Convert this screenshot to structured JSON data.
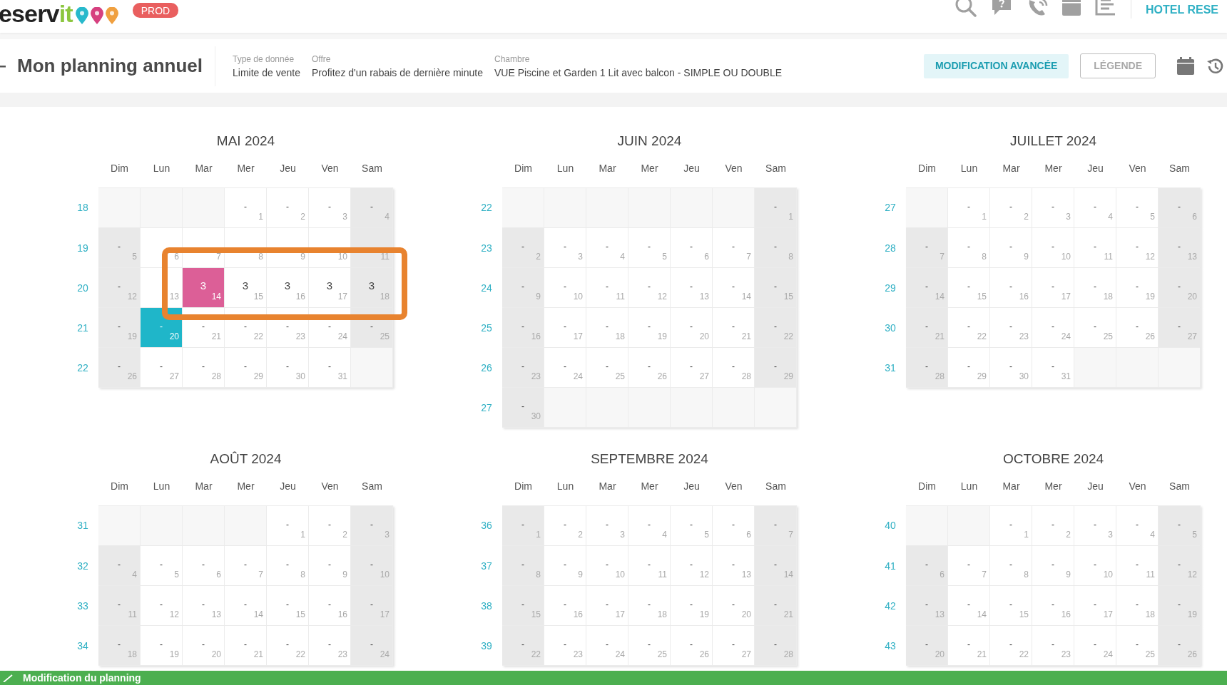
{
  "header": {
    "logo": {
      "main": "eserv",
      "accent": "it"
    },
    "env_badge": "PROD",
    "hotel": "HOTEL RESE"
  },
  "subheader": {
    "title": "Mon planning annuel",
    "fields": [
      {
        "label": "Type de donnée",
        "value": "Limite de vente"
      },
      {
        "label": "Offre",
        "value": "Profitez d'un rabais de dernière minute"
      },
      {
        "label": "Chambre",
        "value": "VUE Piscine et Garden 1 Lit avec balcon - SIMPLE OU DOUBLE"
      }
    ],
    "buttons": [
      {
        "label": "MODIFICATION AVANCÉE",
        "kind": "primary"
      },
      {
        "label": "LÉGENDE",
        "kind": "outline"
      }
    ]
  },
  "months": [
    {
      "title": "MAI 2024",
      "weekdays": [
        "Dim",
        "Lun",
        "Mar",
        "Mer",
        "Jeu",
        "Ven",
        "Sam"
      ],
      "weeks": [
        {
          "number": "18",
          "days": [
            {
              "kind": "blank"
            },
            {
              "kind": "blank"
            },
            {
              "kind": "blank"
            },
            {
              "day": "1",
              "value": "-"
            },
            {
              "day": "2",
              "value": "-"
            },
            {
              "day": "3",
              "value": "-"
            },
            {
              "day": "4",
              "value": "-"
            }
          ]
        },
        {
          "number": "19",
          "days": [
            {
              "day": "5",
              "value": "-"
            },
            {
              "day": "6"
            },
            {
              "day": "7"
            },
            {
              "day": "8"
            },
            {
              "day": "9"
            },
            {
              "day": "10"
            },
            {
              "day": "11"
            }
          ]
        },
        {
          "number": "20",
          "days": [
            {
              "day": "12",
              "value": "-"
            },
            {
              "day": "13"
            },
            {
              "day": "14",
              "value": "3",
              "color": "#dc5f97"
            },
            {
              "day": "15",
              "value": "3"
            },
            {
              "day": "16",
              "value": "3"
            },
            {
              "day": "17",
              "value": "3"
            },
            {
              "day": "18",
              "value": "3"
            }
          ]
        },
        {
          "number": "21",
          "days": [
            {
              "day": "19",
              "value": "-"
            },
            {
              "day": "20",
              "value": "-",
              "color": "#1fb6c9"
            },
            {
              "day": "21",
              "value": "-"
            },
            {
              "day": "22",
              "value": "-"
            },
            {
              "day": "23",
              "value": "-"
            },
            {
              "day": "24",
              "value": "-"
            },
            {
              "day": "25",
              "value": "-"
            }
          ]
        },
        {
          "number": "22",
          "days": [
            {
              "day": "26",
              "value": "-"
            },
            {
              "day": "27",
              "value": "-"
            },
            {
              "day": "28",
              "value": "-"
            },
            {
              "day": "29",
              "value": "-"
            },
            {
              "day": "30",
              "value": "-"
            },
            {
              "day": "31",
              "value": "-"
            },
            {
              "kind": "blank"
            }
          ]
        }
      ]
    },
    {
      "title": "JUIN 2024",
      "weekdays": [
        "Dim",
        "Lun",
        "Mar",
        "Mer",
        "Jeu",
        "Ven",
        "Sam"
      ],
      "weeks": [
        {
          "number": "22",
          "days": [
            {
              "kind": "blank"
            },
            {
              "kind": "blank"
            },
            {
              "kind": "blank"
            },
            {
              "kind": "blank"
            },
            {
              "kind": "blank"
            },
            {
              "kind": "blank"
            },
            {
              "day": "1",
              "value": "-"
            }
          ]
        },
        {
          "number": "23",
          "days": [
            {
              "day": "2",
              "value": "-"
            },
            {
              "day": "3",
              "value": "-"
            },
            {
              "day": "4",
              "value": "-"
            },
            {
              "day": "5",
              "value": "-"
            },
            {
              "day": "6",
              "value": "-"
            },
            {
              "day": "7",
              "value": "-"
            },
            {
              "day": "8",
              "value": "-"
            }
          ]
        },
        {
          "number": "24",
          "days": [
            {
              "day": "9",
              "value": "-"
            },
            {
              "day": "10",
              "value": "-"
            },
            {
              "day": "11",
              "value": "-"
            },
            {
              "day": "12",
              "value": "-"
            },
            {
              "day": "13",
              "value": "-"
            },
            {
              "day": "14",
              "value": "-"
            },
            {
              "day": "15",
              "value": "-"
            }
          ]
        },
        {
          "number": "25",
          "days": [
            {
              "day": "16",
              "value": "-"
            },
            {
              "day": "17",
              "value": "-"
            },
            {
              "day": "18",
              "value": "-"
            },
            {
              "day": "19",
              "value": "-"
            },
            {
              "day": "20",
              "value": "-"
            },
            {
              "day": "21",
              "value": "-"
            },
            {
              "day": "22",
              "value": "-"
            }
          ]
        },
        {
          "number": "26",
          "days": [
            {
              "day": "23",
              "value": "-"
            },
            {
              "day": "24",
              "value": "-"
            },
            {
              "day": "25",
              "value": "-"
            },
            {
              "day": "26",
              "value": "-"
            },
            {
              "day": "27",
              "value": "-"
            },
            {
              "day": "28",
              "value": "-"
            },
            {
              "day": "29",
              "value": "-"
            }
          ]
        },
        {
          "number": "27",
          "days": [
            {
              "day": "30",
              "value": "-"
            },
            {
              "kind": "blank"
            },
            {
              "kind": "blank"
            },
            {
              "kind": "blank"
            },
            {
              "kind": "blank"
            },
            {
              "kind": "blank"
            },
            {
              "kind": "blank"
            }
          ]
        }
      ]
    },
    {
      "title": "JUILLET 2024",
      "weekdays": [
        "Dim",
        "Lun",
        "Mar",
        "Mer",
        "Jeu",
        "Ven",
        "Sam"
      ],
      "weeks": [
        {
          "number": "27",
          "days": [
            {
              "kind": "blank"
            },
            {
              "day": "1",
              "value": "-"
            },
            {
              "day": "2",
              "value": "-"
            },
            {
              "day": "3",
              "value": "-"
            },
            {
              "day": "4",
              "value": "-"
            },
            {
              "day": "5",
              "value": "-"
            },
            {
              "day": "6",
              "value": "-"
            }
          ]
        },
        {
          "number": "28",
          "days": [
            {
              "day": "7",
              "value": "-"
            },
            {
              "day": "8",
              "value": "-"
            },
            {
              "day": "9",
              "value": "-"
            },
            {
              "day": "10",
              "value": "-"
            },
            {
              "day": "11",
              "value": "-"
            },
            {
              "day": "12",
              "value": "-"
            },
            {
              "day": "13",
              "value": "-"
            }
          ]
        },
        {
          "number": "29",
          "days": [
            {
              "day": "14",
              "value": "-"
            },
            {
              "day": "15",
              "value": "-"
            },
            {
              "day": "16",
              "value": "-"
            },
            {
              "day": "17",
              "value": "-"
            },
            {
              "day": "18",
              "value": "-"
            },
            {
              "day": "19",
              "value": "-"
            },
            {
              "day": "20",
              "value": "-"
            }
          ]
        },
        {
          "number": "30",
          "days": [
            {
              "day": "21",
              "value": "-"
            },
            {
              "day": "22",
              "value": "-"
            },
            {
              "day": "23",
              "value": "-"
            },
            {
              "day": "24",
              "value": "-"
            },
            {
              "day": "25",
              "value": "-"
            },
            {
              "day": "26",
              "value": "-"
            },
            {
              "day": "27",
              "value": "-"
            }
          ]
        },
        {
          "number": "31",
          "days": [
            {
              "day": "28",
              "value": "-"
            },
            {
              "day": "29",
              "value": "-"
            },
            {
              "day": "30",
              "value": "-"
            },
            {
              "day": "31",
              "value": "-"
            },
            {
              "kind": "blank"
            },
            {
              "kind": "blank"
            },
            {
              "kind": "blank"
            }
          ]
        }
      ]
    },
    {
      "title": "AOÛT 2024",
      "weekdays": [
        "Dim",
        "Lun",
        "Mar",
        "Mer",
        "Jeu",
        "Ven",
        "Sam"
      ],
      "weeks": [
        {
          "number": "31",
          "days": [
            {
              "kind": "blank"
            },
            {
              "kind": "blank"
            },
            {
              "kind": "blank"
            },
            {
              "kind": "blank"
            },
            {
              "day": "1",
              "value": "-"
            },
            {
              "day": "2",
              "value": "-"
            },
            {
              "day": "3",
              "value": "-"
            }
          ]
        },
        {
          "number": "32",
          "days": [
            {
              "day": "4",
              "value": "-"
            },
            {
              "day": "5",
              "value": "-"
            },
            {
              "day": "6",
              "value": "-"
            },
            {
              "day": "7",
              "value": "-"
            },
            {
              "day": "8",
              "value": "-"
            },
            {
              "day": "9",
              "value": "-"
            },
            {
              "day": "10",
              "value": "-"
            }
          ]
        },
        {
          "number": "33",
          "days": [
            {
              "day": "11",
              "value": "-"
            },
            {
              "day": "12",
              "value": "-"
            },
            {
              "day": "13",
              "value": "-"
            },
            {
              "day": "14",
              "value": "-"
            },
            {
              "day": "15",
              "value": "-"
            },
            {
              "day": "16",
              "value": "-"
            },
            {
              "day": "17",
              "value": "-"
            }
          ]
        },
        {
          "number": "34",
          "days": [
            {
              "day": "18",
              "value": "-"
            },
            {
              "day": "19",
              "value": "-"
            },
            {
              "day": "20",
              "value": "-"
            },
            {
              "day": "21",
              "value": "-"
            },
            {
              "day": "22",
              "value": "-"
            },
            {
              "day": "23",
              "value": "-"
            },
            {
              "day": "24",
              "value": "-"
            }
          ]
        }
      ]
    },
    {
      "title": "SEPTEMBRE 2024",
      "weekdays": [
        "Dim",
        "Lun",
        "Mar",
        "Mer",
        "Jeu",
        "Ven",
        "Sam"
      ],
      "weeks": [
        {
          "number": "36",
          "days": [
            {
              "day": "1",
              "value": "-"
            },
            {
              "day": "2",
              "value": "-"
            },
            {
              "day": "3",
              "value": "-"
            },
            {
              "day": "4",
              "value": "-"
            },
            {
              "day": "5",
              "value": "-"
            },
            {
              "day": "6",
              "value": "-"
            },
            {
              "day": "7",
              "value": "-"
            }
          ]
        },
        {
          "number": "37",
          "days": [
            {
              "day": "8",
              "value": "-"
            },
            {
              "day": "9",
              "value": "-"
            },
            {
              "day": "10",
              "value": "-"
            },
            {
              "day": "11",
              "value": "-"
            },
            {
              "day": "12",
              "value": "-"
            },
            {
              "day": "13",
              "value": "-"
            },
            {
              "day": "14",
              "value": "-"
            }
          ]
        },
        {
          "number": "38",
          "days": [
            {
              "day": "15",
              "value": "-"
            },
            {
              "day": "16",
              "value": "-"
            },
            {
              "day": "17",
              "value": "-"
            },
            {
              "day": "18",
              "value": "-"
            },
            {
              "day": "19",
              "value": "-"
            },
            {
              "day": "20",
              "value": "-"
            },
            {
              "day": "21",
              "value": "-"
            }
          ]
        },
        {
          "number": "39",
          "days": [
            {
              "day": "22",
              "value": "-"
            },
            {
              "day": "23",
              "value": "-"
            },
            {
              "day": "24",
              "value": "-"
            },
            {
              "day": "25",
              "value": "-"
            },
            {
              "day": "26",
              "value": "-"
            },
            {
              "day": "27",
              "value": "-"
            },
            {
              "day": "28",
              "value": "-"
            }
          ]
        }
      ]
    },
    {
      "title": "OCTOBRE 2024",
      "weekdays": [
        "Dim",
        "Lun",
        "Mar",
        "Mer",
        "Jeu",
        "Ven",
        "Sam"
      ],
      "weeks": [
        {
          "number": "40",
          "days": [
            {
              "kind": "blank"
            },
            {
              "kind": "blank"
            },
            {
              "day": "1",
              "value": "-"
            },
            {
              "day": "2",
              "value": "-"
            },
            {
              "day": "3",
              "value": "-"
            },
            {
              "day": "4",
              "value": "-"
            },
            {
              "day": "5",
              "value": "-"
            }
          ]
        },
        {
          "number": "41",
          "days": [
            {
              "day": "6",
              "value": "-"
            },
            {
              "day": "7",
              "value": "-"
            },
            {
              "day": "8",
              "value": "-"
            },
            {
              "day": "9",
              "value": "-"
            },
            {
              "day": "10",
              "value": "-"
            },
            {
              "day": "11",
              "value": "-"
            },
            {
              "day": "12",
              "value": "-"
            }
          ]
        },
        {
          "number": "42",
          "days": [
            {
              "day": "13",
              "value": "-"
            },
            {
              "day": "14",
              "value": "-"
            },
            {
              "day": "15",
              "value": "-"
            },
            {
              "day": "16",
              "value": "-"
            },
            {
              "day": "17",
              "value": "-"
            },
            {
              "day": "18",
              "value": "-"
            },
            {
              "day": "19",
              "value": "-"
            }
          ]
        },
        {
          "number": "43",
          "days": [
            {
              "day": "20",
              "value": "-"
            },
            {
              "day": "21",
              "value": "-"
            },
            {
              "day": "22",
              "value": "-"
            },
            {
              "day": "23",
              "value": "-"
            },
            {
              "day": "24",
              "value": "-"
            },
            {
              "day": "25",
              "value": "-"
            },
            {
              "day": "26",
              "value": "-"
            }
          ]
        }
      ]
    }
  ],
  "status_bar": {
    "message": "Modification du planning"
  }
}
